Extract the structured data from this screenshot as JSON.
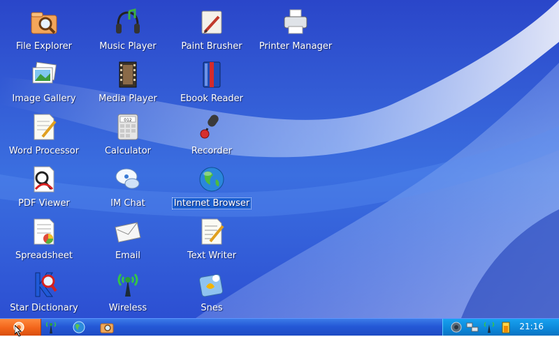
{
  "desktop": {
    "icons": [
      {
        "label": "File Explorer",
        "icon": "folder-magnifier-icon"
      },
      {
        "label": "Music Player",
        "icon": "headphones-icon"
      },
      {
        "label": "Paint Brusher",
        "icon": "paint-brush-icon"
      },
      {
        "label": "Printer Manager",
        "icon": "printer-icon"
      },
      {
        "label": "Image Gallery",
        "icon": "photos-icon"
      },
      {
        "label": "Media Player",
        "icon": "film-strip-icon"
      },
      {
        "label": "Ebook Reader",
        "icon": "book-icon"
      },
      {
        "label": "Word Processor",
        "icon": "document-pencil-icon"
      },
      {
        "label": "Calculator",
        "icon": "calculator-icon"
      },
      {
        "label": "Recorder",
        "icon": "microphone-icon"
      },
      {
        "label": "PDF Viewer",
        "icon": "pdf-icon"
      },
      {
        "label": "IM Chat",
        "icon": "chat-bubbles-icon"
      },
      {
        "label": "Internet Browser",
        "icon": "globe-icon"
      },
      {
        "label": "Spreadsheet",
        "icon": "spreadsheet-icon"
      },
      {
        "label": "Email",
        "icon": "envelope-icon"
      },
      {
        "label": "Text Writer",
        "icon": "text-pencil-icon"
      },
      {
        "label": "Star Dictionary",
        "icon": "dictionary-icon"
      },
      {
        "label": "Wireless",
        "icon": "wireless-antenna-icon"
      },
      {
        "label": "Snes",
        "icon": "game-icon"
      }
    ],
    "selected": "Internet Browser"
  },
  "calculator_display": "012",
  "taskbar": {
    "quick_launch": [
      "wireless-antenna-icon",
      "globe-icon",
      "folder-magnifier-icon"
    ],
    "tray_icons": [
      "speaker-icon",
      "network-icon",
      "wireless-signal-icon",
      "battery-icon"
    ],
    "clock": "21:16"
  },
  "colors": {
    "desktop": "#2f56d6",
    "taskbar": "#2458d6",
    "start": "#f2641a",
    "tray": "#0c86d8",
    "selection": "#1a5fd0"
  }
}
